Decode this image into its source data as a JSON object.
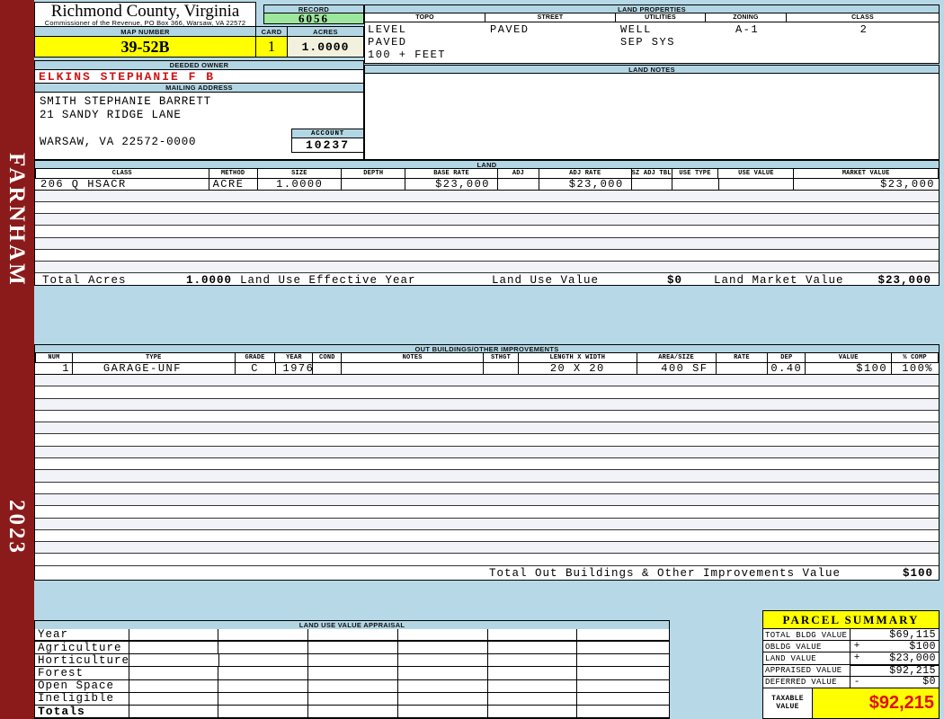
{
  "colors": {
    "spine_maroon": "#8b1b1b",
    "header_blue": "#b3d6e4",
    "record_green": "#9de69d",
    "highlight_yellow": "#ffff00",
    "acres_cream": "#f2f1dd",
    "owner_red": "#cc1414",
    "taxable_red": "#e01010"
  },
  "sidebar": {
    "district": "FARNHAM",
    "year": "2023"
  },
  "header": {
    "county": "Richmond County, Virginia",
    "commissioner_line": "Commissioner of the Revenue, PO Box 366, Warsaw, VA 22572",
    "record_label": "RECORD",
    "record_value": "6056",
    "map_number_label": "MAP NUMBER",
    "map_number": "39-52B",
    "card_label": "CARD",
    "card": "1",
    "acres_label": "ACRES",
    "acres": "1.0000"
  },
  "owner": {
    "deeded_owner_label": "DEEDED OWNER",
    "name": "ELKINS STEPHANIE F B",
    "mailing_address_label": "MAILING ADDRESS",
    "address_lines": [
      "SMITH STEPHANIE BARRETT",
      "21 SANDY RIDGE LANE",
      "",
      "WARSAW, VA 22572-0000"
    ],
    "account_label": "ACCOUNT",
    "account": "10237"
  },
  "land_properties": {
    "title": "LAND PROPERTIES",
    "columns": [
      "TOPO",
      "STREET",
      "UTILITIES",
      "ZONING",
      "CLASS"
    ],
    "topo": [
      "LEVEL",
      "PAVED",
      "100 + FEET"
    ],
    "street": "PAVED",
    "utilities": [
      "WELL",
      "SEP SYS"
    ],
    "zoning": "A-1",
    "class": "2"
  },
  "land_notes": {
    "title": "LAND NOTES",
    "text": ""
  },
  "land": {
    "title": "LAND",
    "columns": [
      "CLASS",
      "METHOD",
      "SIZE",
      "DEPTH",
      "BASE RATE",
      "ADJ",
      "ADJ RATE",
      "SZ ADJ TBL",
      "USE TYPE",
      "USE VALUE",
      "MARKET VALUE"
    ],
    "rows": [
      [
        "206 Q HSACR",
        "ACRE",
        "1.0000",
        "",
        "$23,000",
        "",
        "$23,000",
        "",
        "",
        "",
        "$23,000"
      ]
    ],
    "totals": {
      "total_acres_label": "Total Acres",
      "total_acres": "1.0000",
      "effective_year_label": "Land Use Effective Year",
      "use_value_label": "Land Use Value",
      "use_value": "$0",
      "market_value_label": "Land Market Value",
      "market_value": "$23,000"
    }
  },
  "out_buildings": {
    "title": "OUT BUILDINGS/OTHER IMPROVEMENTS",
    "columns": [
      "NUM",
      "TYPE",
      "GRADE",
      "YEAR",
      "COND",
      "NOTES",
      "STHGT",
      "LENGTH X WIDTH",
      "AREA/SIZE",
      "RATE",
      "DEP",
      "VALUE",
      "% COMP"
    ],
    "rows": [
      [
        "1",
        "GARAGE-UNF",
        "C",
        "1976",
        "",
        "",
        "",
        "20 X 20",
        "400 SF",
        "",
        "0.40",
        "$100",
        "100%"
      ]
    ],
    "total_label": "Total Out Buildings & Other Improvements Value",
    "total_value": "$100"
  },
  "land_use_appraisal": {
    "title": "LAND USE VALUE APPRAISAL",
    "row_labels": [
      "Year",
      "Agriculture",
      "Horticulture",
      "Forest",
      "Open Space",
      "Ineligible",
      "Totals"
    ]
  },
  "parcel_summary": {
    "title": "PARCEL SUMMARY",
    "rows": [
      {
        "label": "TOTAL BLDG VALUE",
        "op": "",
        "value": "$69,115"
      },
      {
        "label": "OBLDG VALUE",
        "op": "+",
        "value": "$100"
      },
      {
        "label": "LAND VALUE",
        "op": "+",
        "value": "$23,000"
      },
      {
        "label": "APPRAISED VALUE",
        "op": "",
        "value": "$92,215"
      },
      {
        "label": "DEFERRED VALUE",
        "op": "-",
        "value": "$0"
      }
    ],
    "taxable_label": "TAXABLE VALUE",
    "taxable_value": "$92,215"
  }
}
